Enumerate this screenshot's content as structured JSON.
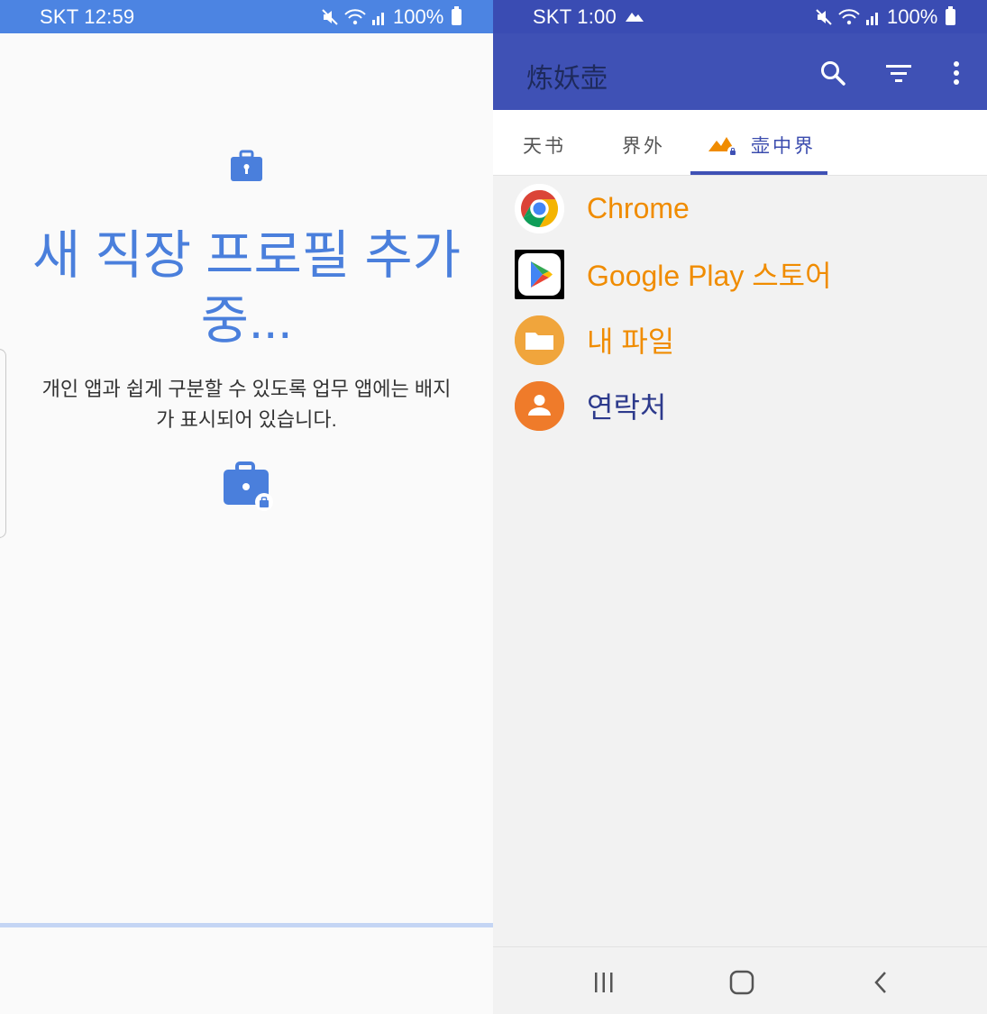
{
  "left_screen": {
    "status_bar": {
      "carrier_time": "SKT 12:59",
      "battery": "100%"
    },
    "title": "새 직장 프로필 추가 중...",
    "description": "개인 앱과 쉽게 구분할 수 있도록 업무 앱에는 배지가 표시되어 있습니다.",
    "progress": 1.0,
    "colors": {
      "accent": "#4a7fdc",
      "status_bar": "#4c84e2"
    }
  },
  "right_screen": {
    "status_bar": {
      "carrier_time": "SKT 1:00",
      "battery": "100%"
    },
    "app_bar": {
      "title": "炼妖壶",
      "actions": [
        "search-icon",
        "filter-icon",
        "more-vert-icon"
      ]
    },
    "tabs": [
      {
        "label": "天书",
        "active": false
      },
      {
        "label": "界外",
        "active": false
      },
      {
        "label": "壶中界",
        "active": true,
        "icon": "island-badge-icon"
      }
    ],
    "apps": [
      {
        "name": "Chrome",
        "icon": "chrome-icon",
        "color": "#f08c00"
      },
      {
        "name": "Google Play 스토어",
        "icon": "play-store-icon",
        "color": "#f08c00"
      },
      {
        "name": "내 파일",
        "icon": "my-files-icon",
        "color": "#f08c00"
      },
      {
        "name": "연락처",
        "icon": "contacts-icon",
        "color": "#2d3a8c"
      }
    ],
    "nav_bar": [
      "recents-icon",
      "home-icon",
      "back-icon"
    ],
    "colors": {
      "app_bar": "#3f51b5",
      "status_bar": "#3a4cb3",
      "highlight": "#f08c00"
    }
  }
}
